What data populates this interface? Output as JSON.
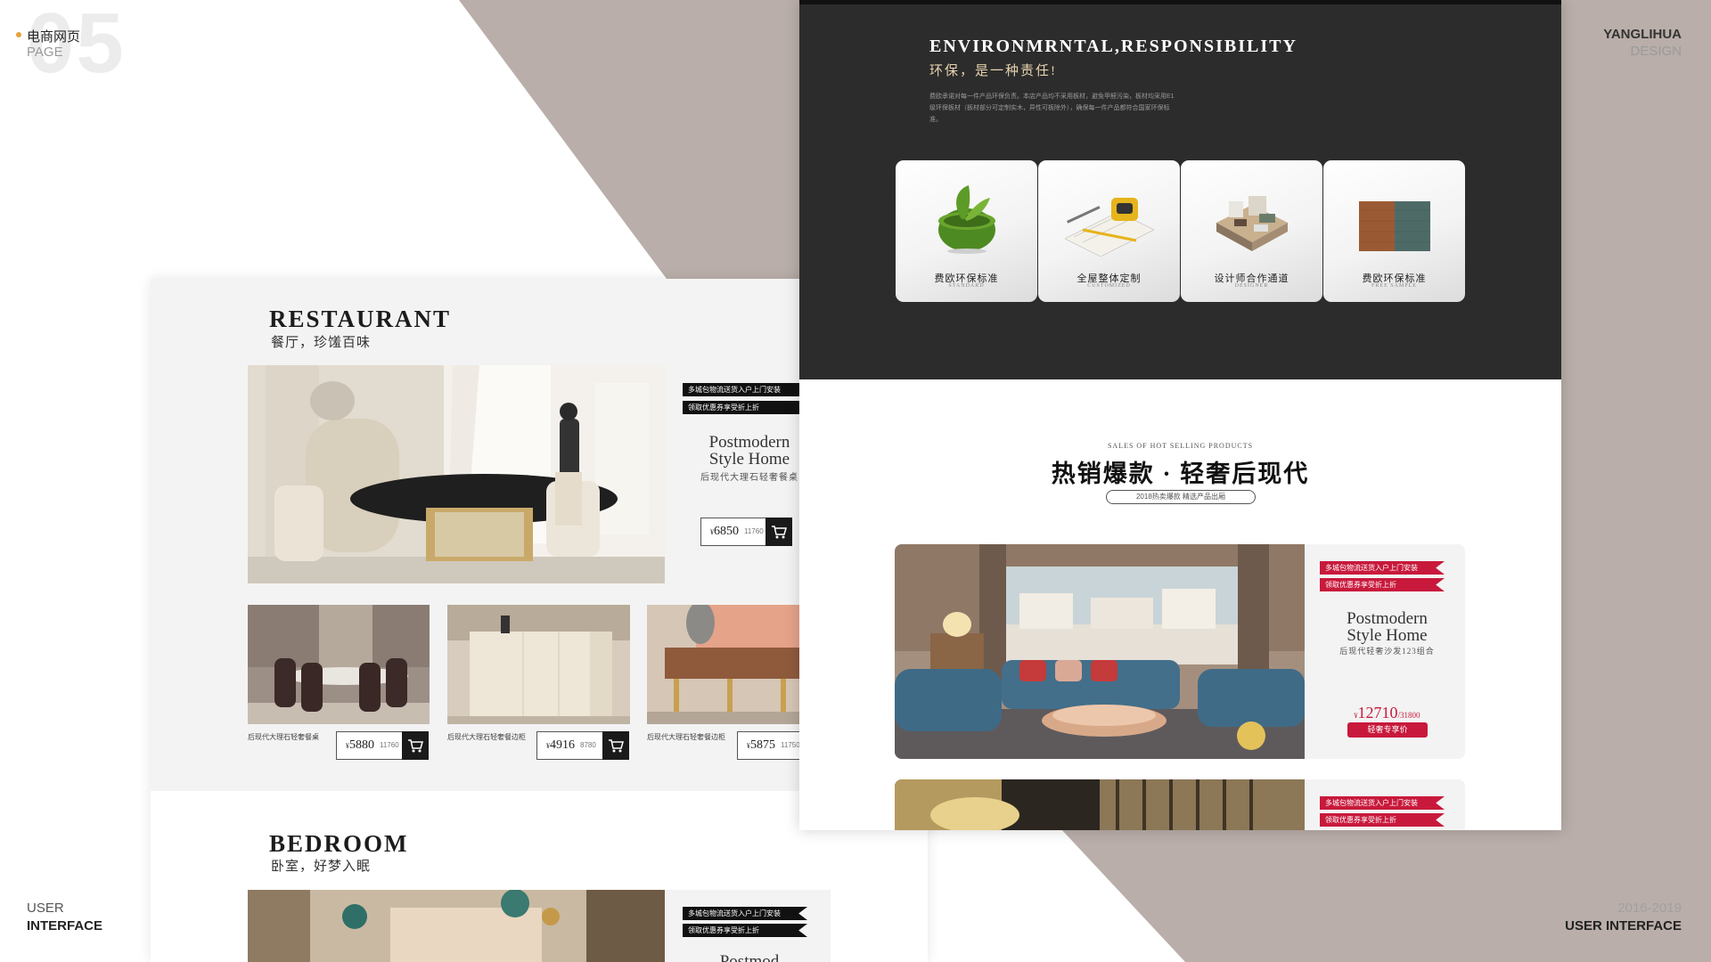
{
  "corner": {
    "big_number": "05",
    "top_left_title": "电商网页",
    "top_left_sub": "PAGE",
    "top_right_1": "YANGLIHUA",
    "top_right_2": "DESIGN",
    "bottom_left_1": "USER",
    "bottom_left_2": "INTERFACE",
    "bottom_right_1": "2016-2019",
    "bottom_right_2": "USER INTERFACE"
  },
  "colors": {
    "bg_taupe": "#b9aea9",
    "dark_section": "#2c2c2c",
    "accent_red": "#c8193c",
    "accent_gold": "#e7d3ad"
  },
  "restaurant": {
    "title": "RESTAURANT",
    "subtitle": "餐厅，珍馐百味",
    "tag1": "多城包物流送货入户上门安装",
    "tag2": "领取优惠券享受折上折",
    "product_name_line1": "Postmodern",
    "product_name_line2": "Style Home",
    "product_sub": "后现代大理石轻奢餐桌",
    "price_symbol": "¥",
    "price": "6850",
    "original": "11760",
    "thumbs": [
      {
        "caption": "后现代大理石轻奢餐桌",
        "price_symbol": "¥",
        "price": "5880",
        "original": "11760"
      },
      {
        "caption": "后现代大理石轻奢餐边柜",
        "price_symbol": "¥",
        "price": "4916",
        "original": "8780"
      },
      {
        "caption": "后现代大理石轻奢餐边柜",
        "price_symbol": "¥",
        "price": "5875",
        "original": "11750"
      }
    ],
    "image_icon": "cart-icon"
  },
  "bedroom": {
    "title": "BEDROOM",
    "subtitle": "卧室，好梦入眠",
    "tag1": "多城包物流送货入户上门安装",
    "tag2": "领取优惠券享受折上折",
    "product_name_partial": "Postmod"
  },
  "environment": {
    "title": "ENVIRONMRNTAL,RESPONSIBILITY",
    "subtitle": "环保，是一种责任!",
    "desc": "费欧承诺对每一件产品环保负责。本店产品均不采用板材，避免甲醛污染，板材均采用E1级环保板材（板材部分可定制实木，异性可板除外），确保每一件产品都符合国家环保标准。",
    "cards": [
      {
        "title": "费欧环保标准",
        "sub": "STANDARD",
        "icon": "green-bowl-icon"
      },
      {
        "title": "全屋整体定制",
        "sub": "CUSTOMIZED",
        "icon": "measuring-tape-icon"
      },
      {
        "title": "设计师合作通道",
        "sub": "DESIGNER",
        "icon": "house-model-icon"
      },
      {
        "title": "费欧环保标准",
        "sub": "FREE SAMPLE",
        "icon": "fabric-sample-icon"
      }
    ]
  },
  "hot": {
    "small": "SALES OF HOT SELLING PRODUCTS",
    "title": "热销爆款 · 轻奢后现代",
    "pill": "2018热卖爆款 精选产品出厢",
    "card1": {
      "tag1": "多城包物流送货入户上门安装",
      "tag2": "领取优惠券享受折上折",
      "name_line1": "Postmodern",
      "name_line2": "Style Home",
      "sub": "后现代轻奢沙发123组合",
      "price_symbol": "¥",
      "price": "12710",
      "original": "/31800",
      "button": "轻奢专享价"
    },
    "card2": {
      "tag1": "多城包物流送货入户上门安装",
      "tag2": "领取优惠券享受折上折"
    }
  }
}
